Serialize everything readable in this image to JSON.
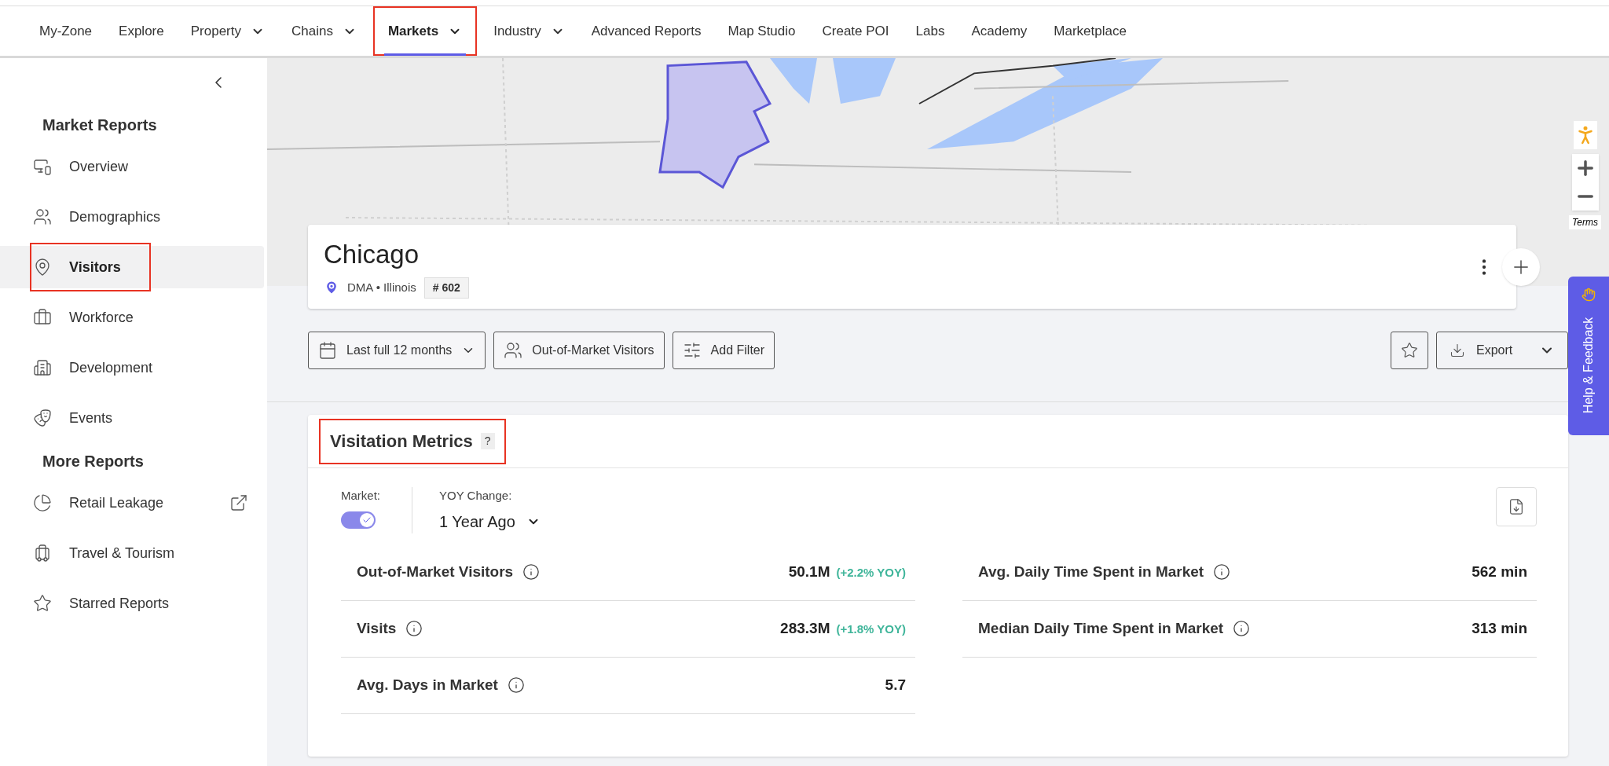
{
  "nav": {
    "items": [
      {
        "label": "My-Zone",
        "selected": false,
        "dropdown": false,
        "highlighted": false
      },
      {
        "label": "Explore",
        "selected": false,
        "dropdown": false,
        "highlighted": false
      },
      {
        "label": "Property",
        "selected": false,
        "dropdown": true,
        "highlighted": false
      },
      {
        "label": "Chains",
        "selected": false,
        "dropdown": true,
        "highlighted": false
      },
      {
        "label": "Markets",
        "selected": true,
        "dropdown": true,
        "highlighted": true
      },
      {
        "label": "Industry",
        "selected": false,
        "dropdown": true,
        "highlighted": false
      },
      {
        "label": "Advanced Reports",
        "selected": false,
        "dropdown": false,
        "highlighted": false
      },
      {
        "label": "Map Studio",
        "selected": false,
        "dropdown": false,
        "highlighted": false
      },
      {
        "label": "Create POI",
        "selected": false,
        "dropdown": false,
        "highlighted": false
      },
      {
        "label": "Labs",
        "selected": false,
        "dropdown": false,
        "highlighted": false
      },
      {
        "label": "Academy",
        "selected": false,
        "dropdown": false,
        "highlighted": false
      },
      {
        "label": "Marketplace",
        "selected": false,
        "dropdown": false,
        "highlighted": false
      }
    ]
  },
  "sidebar": {
    "sections": [
      {
        "title": "Market Reports",
        "items": [
          {
            "label": "Overview",
            "selected": false,
            "highlighted": false,
            "external": false
          },
          {
            "label": "Demographics",
            "selected": false,
            "highlighted": false,
            "external": false
          },
          {
            "label": "Visitors",
            "selected": true,
            "highlighted": true,
            "external": false
          },
          {
            "label": "Workforce",
            "selected": false,
            "highlighted": false,
            "external": false
          },
          {
            "label": "Development",
            "selected": false,
            "highlighted": false,
            "external": false
          },
          {
            "label": "Events",
            "selected": false,
            "highlighted": false,
            "external": false
          }
        ]
      },
      {
        "title": "More Reports",
        "items": [
          {
            "label": "Retail Leakage",
            "selected": false,
            "highlighted": false,
            "external": true
          },
          {
            "label": "Travel & Tourism",
            "selected": false,
            "highlighted": false,
            "external": false
          },
          {
            "label": "Starred Reports",
            "selected": false,
            "highlighted": false,
            "external": false
          }
        ]
      }
    ]
  },
  "map": {
    "terms": "Terms"
  },
  "header": {
    "title": "Chicago",
    "subtitle": "DMA • Illinois",
    "rank": "# 602"
  },
  "filters": [
    {
      "label": "Last full 12 months",
      "kind": "date"
    },
    {
      "label": "Out-of-Market Visitors",
      "kind": "visitors"
    },
    {
      "label": "Add Filter",
      "kind": "filter"
    }
  ],
  "export": "Export",
  "help_tab": "Help & Feedback",
  "metrics": {
    "title": "Visitation Metrics",
    "help": "?",
    "highlighted": true,
    "market_label": "Market:",
    "market_on": true,
    "yoy_label": "YOY Change:",
    "yoy_value": "1 Year Ago",
    "left": [
      {
        "label": "Out-of-Market Visitors",
        "value": "50.1M",
        "change": "(+2.2% YOY)"
      },
      {
        "label": "Visits",
        "value": "283.3M",
        "change": "(+1.8% YOY)"
      },
      {
        "label": "Avg. Days in Market",
        "value": "5.7"
      }
    ],
    "right": [
      {
        "label": "Avg. Daily Time Spent in Market",
        "value": "562 min"
      },
      {
        "label": "Median Daily Time Spent in Market",
        "value": "313 min"
      }
    ]
  }
}
